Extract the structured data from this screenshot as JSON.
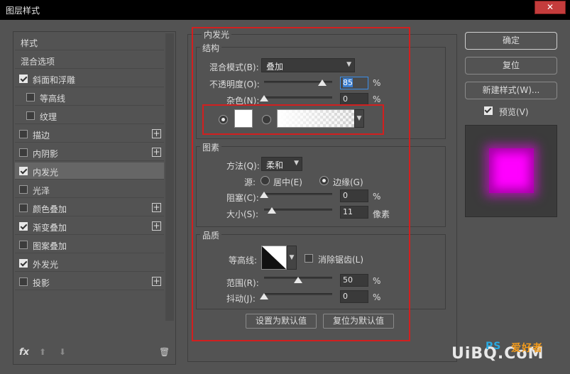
{
  "window": {
    "title": "图层样式",
    "close": "✕"
  },
  "sidebar": {
    "items": [
      {
        "label": "样式",
        "checkbox": false,
        "checked": false,
        "plus": false
      },
      {
        "label": "混合选项",
        "checkbox": false,
        "checked": false,
        "plus": false
      },
      {
        "label": "斜面和浮雕",
        "checkbox": true,
        "checked": true,
        "plus": false
      },
      {
        "label": "等高线",
        "checkbox": true,
        "checked": false,
        "plus": false,
        "sub": true
      },
      {
        "label": "纹理",
        "checkbox": true,
        "checked": false,
        "plus": false,
        "sub": true
      },
      {
        "label": "描边",
        "checkbox": true,
        "checked": false,
        "plus": true
      },
      {
        "label": "内阴影",
        "checkbox": true,
        "checked": false,
        "plus": true
      },
      {
        "label": "内发光",
        "checkbox": true,
        "checked": true,
        "plus": false,
        "selected": true
      },
      {
        "label": "光泽",
        "checkbox": true,
        "checked": false,
        "plus": false
      },
      {
        "label": "颜色叠加",
        "checkbox": true,
        "checked": false,
        "plus": true
      },
      {
        "label": "渐变叠加",
        "checkbox": true,
        "checked": true,
        "plus": true
      },
      {
        "label": "图案叠加",
        "checkbox": true,
        "checked": false,
        "plus": false
      },
      {
        "label": "外发光",
        "checkbox": true,
        "checked": true,
        "plus": false
      },
      {
        "label": "投影",
        "checkbox": true,
        "checked": false,
        "plus": true
      }
    ],
    "footer": {
      "fx": "fx",
      "up": "⬆",
      "down": "⬇",
      "trash": "🗑"
    }
  },
  "panel": {
    "title": "内发光",
    "structure": {
      "title": "结构",
      "blend_label": "混合模式(B):",
      "blend_value": "叠加",
      "opacity_label": "不透明度(O):",
      "opacity_value": "85",
      "opacity_unit": "%",
      "opacity_level": 85,
      "noise_label": "杂色(N):",
      "noise_value": "0",
      "noise_unit": "%",
      "noise_level": 0
    },
    "elements": {
      "title": "图素",
      "method_label": "方法(Q):",
      "method_value": "柔和",
      "source_label": "源:",
      "source_center": "居中(E)",
      "source_edge": "边缘(G)",
      "choke_label": "阻塞(C):",
      "choke_value": "0",
      "choke_unit": "%",
      "choke_level": 0,
      "size_label": "大小(S):",
      "size_value": "11",
      "size_unit": "像素",
      "size_level": 11
    },
    "quality": {
      "title": "品质",
      "contour_label": "等高线:",
      "antialias_label": "消除锯齿(L)",
      "range_label": "范围(R):",
      "range_value": "50",
      "range_unit": "%",
      "range_level": 50,
      "jitter_label": "抖动(J):",
      "jitter_value": "0",
      "jitter_unit": "%",
      "jitter_level": 0
    },
    "buttons": {
      "make_default": "设置为默认值",
      "reset_default": "复位为默认值"
    }
  },
  "right": {
    "ok": "确定",
    "reset": "复位",
    "new_style": "新建样式(W)...",
    "preview_label": "预览(V)",
    "preview_checked": true
  },
  "colors": {
    "accent": "#3b8ee8",
    "highlight": "#d21f1f",
    "preview": "#ff00ff"
  },
  "watermark": {
    "text": "UiBQ.CoM",
    "ps": "PS",
    "site": "爱好者"
  }
}
